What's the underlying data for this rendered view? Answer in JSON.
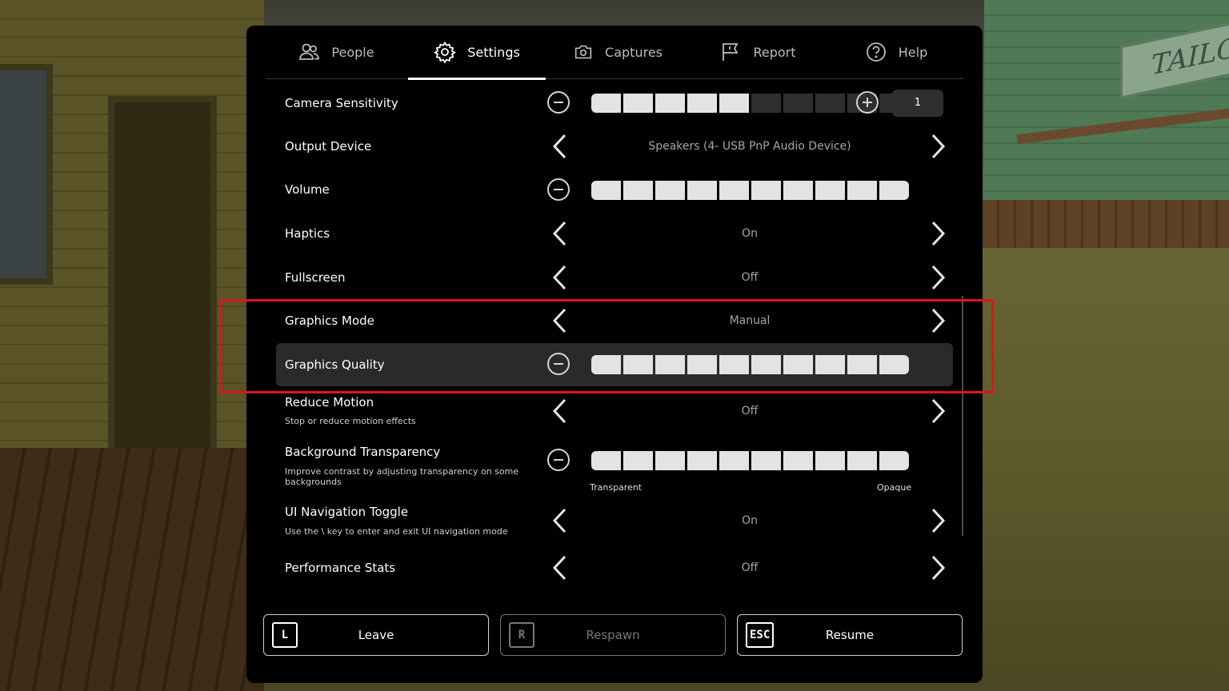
{
  "background": {
    "sign_text": "TAILO"
  },
  "tabs": [
    {
      "label": "People",
      "icon": "people-icon"
    },
    {
      "label": "Settings",
      "icon": "gear-icon",
      "active": true
    },
    {
      "label": "Captures",
      "icon": "camera-icon"
    },
    {
      "label": "Report",
      "icon": "flag-icon"
    },
    {
      "label": "Help",
      "icon": "question-icon"
    }
  ],
  "settings": {
    "camera_sensitivity": {
      "label": "Camera Sensitivity",
      "filled_segments": 5,
      "total_segments": 10,
      "value": "1"
    },
    "output_device": {
      "label": "Output Device",
      "value": "Speakers (4- USB PnP Audio Device)"
    },
    "volume": {
      "label": "Volume",
      "filled_segments": 10,
      "total_segments": 10
    },
    "haptics": {
      "label": "Haptics",
      "value": "On"
    },
    "fullscreen": {
      "label": "Fullscreen",
      "value": "Off"
    },
    "graphics_mode": {
      "label": "Graphics Mode",
      "value": "Manual"
    },
    "graphics_quality": {
      "label": "Graphics Quality",
      "filled_segments": 10,
      "total_segments": 10
    },
    "reduce_motion": {
      "label": "Reduce Motion",
      "description": "Stop or reduce motion effects",
      "value": "Off"
    },
    "background_transparency": {
      "label": "Background Transparency",
      "description": "Improve contrast by adjusting transparency on some backgrounds",
      "filled_segments": 10,
      "total_segments": 10,
      "min_label": "Transparent",
      "max_label": "Opaque"
    },
    "ui_navigation_toggle": {
      "label": "UI Navigation Toggle",
      "description": "Use the \\ key to enter and exit UI navigation mode",
      "value": "On"
    },
    "performance_stats": {
      "label": "Performance Stats",
      "value": "Off"
    }
  },
  "buttons": {
    "leave": {
      "key": "L",
      "label": "Leave"
    },
    "respawn": {
      "key": "R",
      "label": "Respawn",
      "disabled": true
    },
    "resume": {
      "key": "ESC",
      "label": "Resume"
    }
  },
  "colors": {
    "highlight_box": "#e0141c",
    "panel": "#000000",
    "segment_on": "#e3e3e3",
    "segment_off": "#2f2f2f"
  }
}
